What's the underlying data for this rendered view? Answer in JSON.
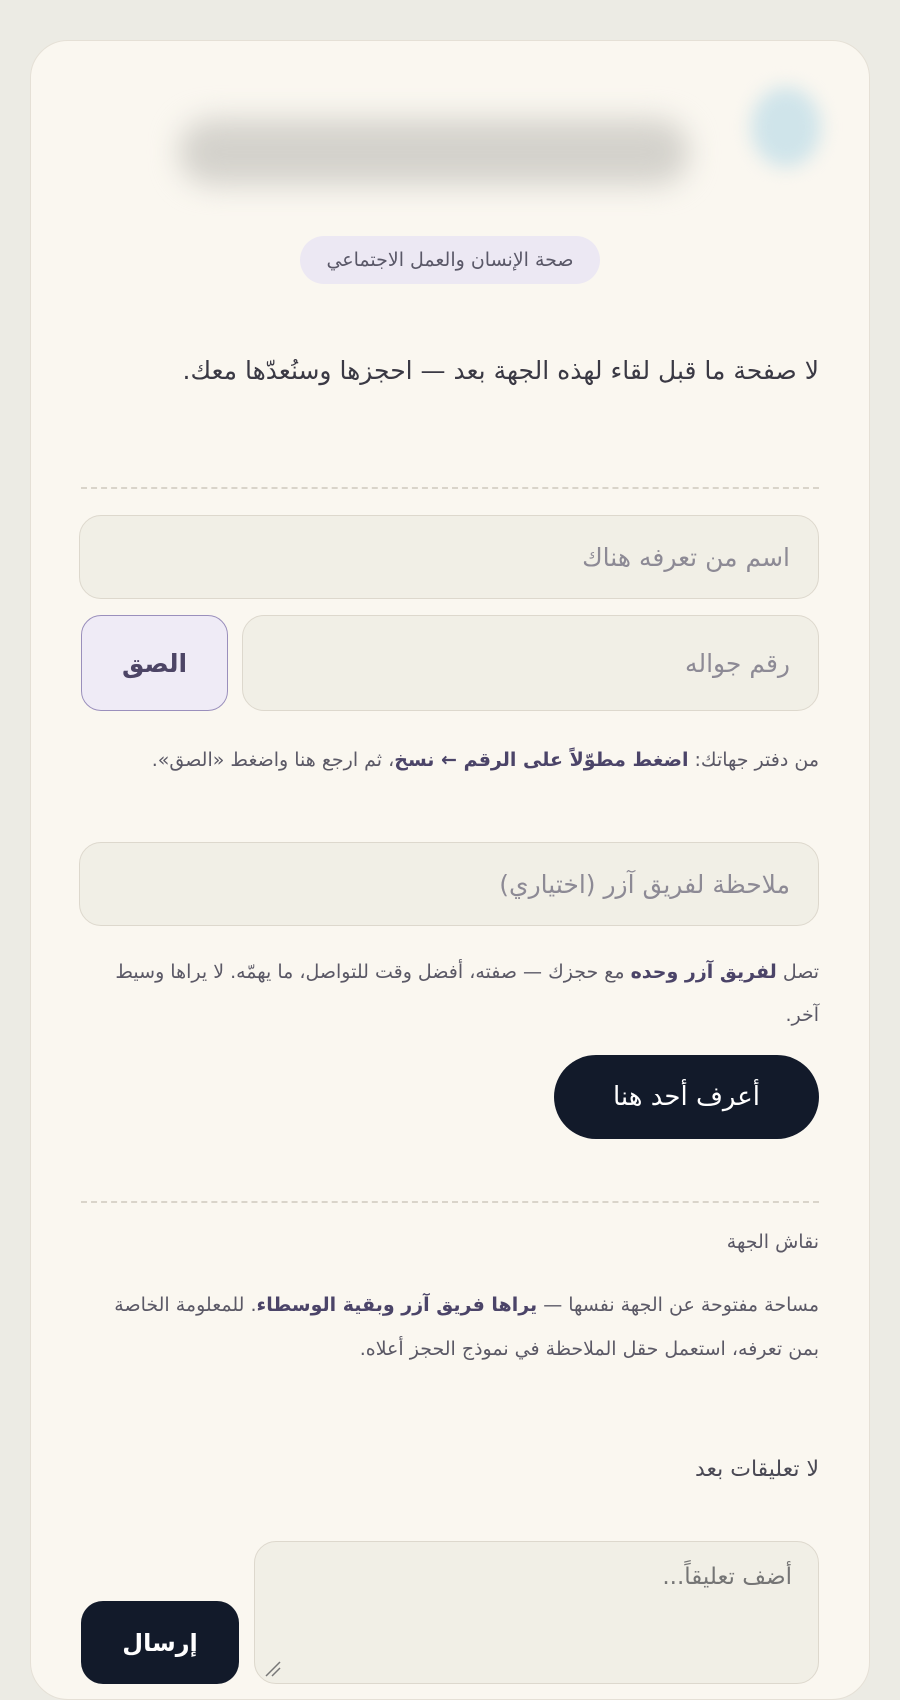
{
  "tag": {
    "label": "صحة الإنسان والعمل الاجتماعي"
  },
  "intro": {
    "text": "لا صفحة ما قبل لقاء لهذه الجهة بعد — احجزها وسنُعدّها معك."
  },
  "form": {
    "name_placeholder": "اسم من تعرفه هناك",
    "phone_placeholder": "رقم جواله",
    "paste_label": "الصق",
    "phone_help": {
      "prefix": "من دفتر جهاتك: ",
      "bold": "اضغط مطوّلاً على الرقم ← نسخ",
      "suffix": "، ثم ارجع هنا واضغط «الصق»."
    },
    "note_placeholder": "ملاحظة لفريق آزر (اختياري)",
    "note_help": {
      "prefix": "تصل ",
      "bold": "لفريق آزر وحده",
      "suffix": " مع حجزك — صفته، أفضل وقت للتواصل، ما يهمّه. لا يراها وسيط آخر."
    },
    "submit_label": "أعرف أحد هنا"
  },
  "discussion": {
    "title": "نقاش الجهة",
    "description": {
      "prefix": "مساحة مفتوحة عن الجهة نفسها — ",
      "bold": "يراها فريق آزر وبقية الوسطاء",
      "suffix": ". للمعلومة الخاصة بمن تعرفه، استعمل حقل الملاحظة في نموذج الحجز أعلاه."
    },
    "empty_state": "لا تعليقات بعد",
    "comment_placeholder": "أضف تعليقاً...",
    "send_label": "إرسال"
  }
}
